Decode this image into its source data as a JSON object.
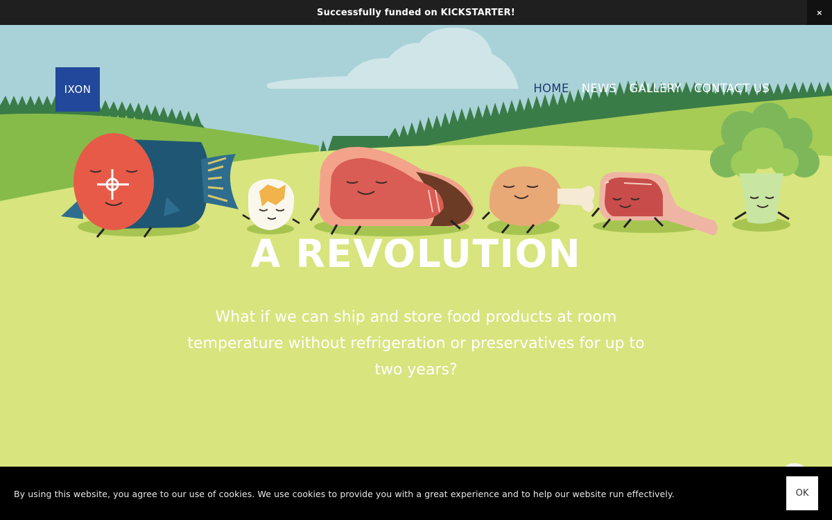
{
  "announcement": {
    "text": "Successfully funded on KICKSTARTER!",
    "close_label": "×"
  },
  "header": {
    "logo_text": "IXON",
    "nav": [
      {
        "label": "HOME",
        "active": true
      },
      {
        "label": "NEWS",
        "active": false
      },
      {
        "label": "GALLERY",
        "active": false
      },
      {
        "label": "CONTACT US",
        "active": false
      }
    ]
  },
  "hero": {
    "headline": "A REVOLUTION",
    "body": "What if we can ship and store food products at room temperature without refrigeration or preservatives for up to two years?"
  },
  "cookie_banner": {
    "text": "By using this website, you agree to our use of cookies. We use cookies to provide you with a great experience and to help our website run effectively.",
    "ok_label": "OK"
  },
  "colors": {
    "sky": "#a9d2d8",
    "meadow": "#d8e47e",
    "hills": "#a6cc56",
    "forest": "#3d8a4e",
    "logo_bg": "#21489a",
    "nav_active": "#1e3a6e"
  }
}
